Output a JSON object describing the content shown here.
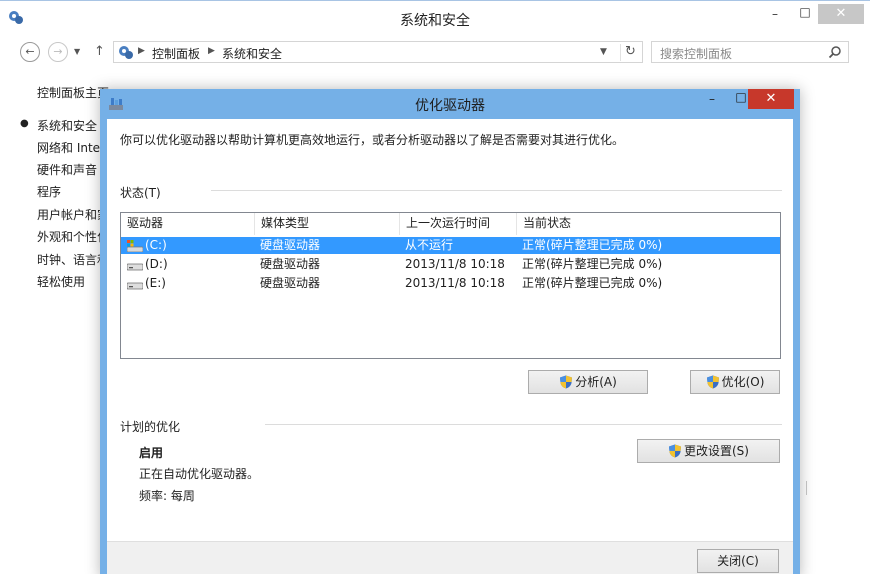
{
  "bg_window": {
    "title": "系统和安全",
    "controls": {
      "min": "–",
      "max": "□",
      "close": "✕"
    },
    "nav": {
      "back": "←",
      "forward": "→",
      "up": "↑",
      "breadcrumbs": [
        "控制面板",
        "系统和安全"
      ],
      "refresh": "↻"
    },
    "search": {
      "placeholder": "搜索控制面板"
    },
    "sidebar": {
      "items": [
        {
          "label": "控制面板主页",
          "active": false
        },
        {
          "label": "系统和安全",
          "active": true
        },
        {
          "label": "网络和 Inte",
          "active": false
        },
        {
          "label": "硬件和声音",
          "active": false
        },
        {
          "label": "程序",
          "active": false
        },
        {
          "label": "用户帐户和家",
          "active": false
        },
        {
          "label": "外观和个性化",
          "active": false
        },
        {
          "label": "时钟、语言和",
          "active": false
        },
        {
          "label": "轻松使用",
          "active": false
        }
      ]
    }
  },
  "dialog": {
    "title": "优化驱动器",
    "controls": {
      "min": "–",
      "max": "□",
      "close": "✕"
    },
    "intro": "你可以优化驱动器以帮助计算机更高效地运行，或者分析驱动器以了解是否需要对其进行优化。",
    "status_label": "状态(T)",
    "columns": [
      "驱动器",
      "媒体类型",
      "上一次运行时间",
      "当前状态"
    ],
    "drives": [
      {
        "drive": "(C:)",
        "media": "硬盘驱动器",
        "last_run": "从不运行",
        "status": "正常(碎片整理已完成 0%)",
        "selected": true,
        "icon": "system-drive-icon"
      },
      {
        "drive": "(D:)",
        "media": "硬盘驱动器",
        "last_run": "2013/11/8 10:18",
        "status": "正常(碎片整理已完成 0%)",
        "selected": false,
        "icon": "hard-drive-icon"
      },
      {
        "drive": "(E:)",
        "media": "硬盘驱动器",
        "last_run": "2013/11/8 10:18",
        "status": "正常(碎片整理已完成 0%)",
        "selected": false,
        "icon": "hard-drive-icon"
      }
    ],
    "analyze_label": "分析(A)",
    "optimize_label": "优化(O)",
    "schedule": {
      "title": "计划的优化",
      "state": "启用",
      "desc": "正在自动优化驱动器。",
      "frequency": "频率: 每周",
      "change_label": "更改设置(S)"
    },
    "close_label": "关闭(C)"
  },
  "colors": {
    "dialog_border": "#75b0e7",
    "close_red": "#c7382b",
    "selection_blue": "#3399ff"
  }
}
